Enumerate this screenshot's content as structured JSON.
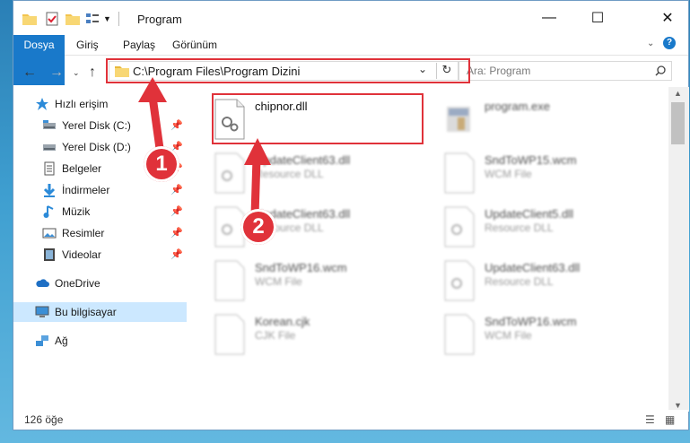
{
  "window": {
    "title": "Program"
  },
  "ribbon": {
    "tabs": [
      "Dosya",
      "Giriş",
      "Paylaş",
      "Görünüm"
    ]
  },
  "address": {
    "path": "C:\\Program Files\\Program Dizini"
  },
  "search": {
    "placeholder": "Ara: Program"
  },
  "sidebar": {
    "items": [
      {
        "label": "Hızlı erişim",
        "icon": "star-icon"
      },
      {
        "label": "Yerel Disk (C:)",
        "icon": "drive-icon"
      },
      {
        "label": "Yerel Disk (D:)",
        "icon": "drive-icon"
      },
      {
        "label": "Belgeler",
        "icon": "documents-icon"
      },
      {
        "label": "İndirmeler",
        "icon": "download-icon"
      },
      {
        "label": "Müzik",
        "icon": "music-icon"
      },
      {
        "label": "Resimler",
        "icon": "pictures-icon"
      },
      {
        "label": "Videolar",
        "icon": "videos-icon"
      },
      {
        "label": "OneDrive",
        "icon": "cloud-icon"
      },
      {
        "label": "Bu bilgisayar",
        "icon": "computer-icon"
      },
      {
        "label": "Ağ",
        "icon": "network-icon"
      }
    ]
  },
  "files": [
    {
      "name": "chipnor.dll",
      "type": ""
    },
    {
      "name": "program.exe",
      "type": ""
    },
    {
      "name": "UpdateClient63.dll",
      "type": "Resource DLL"
    },
    {
      "name": "SndToWP15.wcm",
      "type": "WCM File"
    },
    {
      "name": "UpdateClient63.dll",
      "type": "Resource DLL"
    },
    {
      "name": "UpdateClient5.dll",
      "type": "Resource DLL"
    },
    {
      "name": "SndToWP16.wcm",
      "type": "WCM File"
    },
    {
      "name": "UpdateClient63.dll",
      "type": "Resource DLL"
    },
    {
      "name": "Korean.cjk",
      "type": "CJK File"
    },
    {
      "name": "SndToWP16.wcm",
      "type": "WCM File"
    }
  ],
  "status": {
    "count": "126 öğe"
  },
  "callouts": [
    "1",
    "2"
  ],
  "colors": {
    "accent": "#1979ca",
    "highlight": "#e0323a",
    "selected": "#cce8ff"
  }
}
